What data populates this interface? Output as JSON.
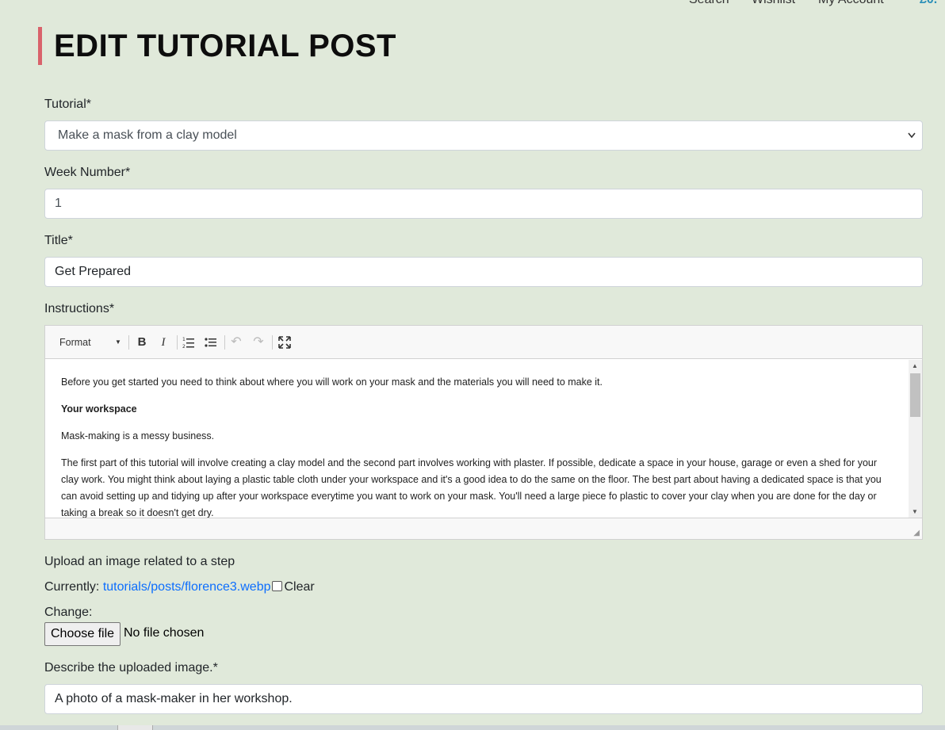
{
  "nav": {
    "search": "Search",
    "wishlist": "Wishlist",
    "account": "My Account",
    "cart": "£0."
  },
  "page": {
    "title": "EDIT TUTORIAL POST"
  },
  "form": {
    "tutorial": {
      "label": "Tutorial*",
      "value": "Make a mask from a clay model"
    },
    "week": {
      "label": "Week Number*",
      "value": "1"
    },
    "title": {
      "label": "Title*",
      "value": "Get Prepared"
    },
    "instructions": {
      "label": "Instructions*",
      "toolbar": {
        "format": "Format",
        "bold": "B",
        "italic": "I",
        "ordered_list": "ordered-list-icon",
        "bullet_list": "bullet-list-icon",
        "undo": "↶",
        "redo": "↷",
        "fullscreen": "⛶"
      },
      "content": {
        "p1": "Before you get started you need to think about where you will work on your mask and the materials you will need to make it.",
        "h1": "Your workspace",
        "p2": "Mask-making is a messy business.",
        "p3": "The first part of this tutorial will involve creating a clay model and the second part involves working with plaster. If possible, dedicate a space in your house, garage or even a shed for your clay work. You might think about laying a plastic table cloth under your workspace and it's a good idea to do the same on the floor. The best part about having a dedicated space is that you can avoid setting up and tidying up after your workspace everytime you want to work on your mask. You'll need a large piece fo plastic to cover your clay when you are done for the day or taking a break so it doesn't get dry."
      }
    },
    "image": {
      "label": "Upload an image related to a step",
      "currently_label": "Currently:",
      "current_file": "tutorials/posts/florence3.webp",
      "clear_label": "Clear",
      "change_label": "Change:",
      "choose_button": "Choose file",
      "file_status": "No file chosen"
    },
    "alt": {
      "label": "Describe the uploaded image.*",
      "value": "A photo of a mask-maker in her workshop."
    }
  }
}
